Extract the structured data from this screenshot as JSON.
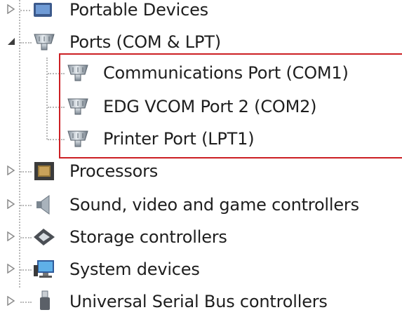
{
  "tree": {
    "portable_devices": {
      "label": "Portable Devices",
      "icon": "portable-devices-icon"
    },
    "ports": {
      "label": "Ports (COM & LPT)",
      "icon": "port-connector-icon",
      "children": [
        {
          "label": "Communications Port (COM1)",
          "icon": "port-connector-icon"
        },
        {
          "label": "EDG VCOM Port 2 (COM2)",
          "icon": "port-connector-icon"
        },
        {
          "label": "Printer Port (LPT1)",
          "icon": "port-connector-icon"
        }
      ]
    },
    "processors": {
      "label": "Processors",
      "icon": "processor-chip-icon"
    },
    "sound": {
      "label": "Sound, video and game controllers",
      "icon": "speaker-icon"
    },
    "storage": {
      "label": "Storage controllers",
      "icon": "storage-controller-icon"
    },
    "system": {
      "label": "System devices",
      "icon": "computer-monitor-icon"
    },
    "usb": {
      "label": "Universal Serial Bus controllers",
      "icon": "usb-plug-icon"
    }
  },
  "colors": {
    "highlight_border": "#cc1f24",
    "tree_lines": "#b9b9b9",
    "text": "#1e1e1e"
  }
}
